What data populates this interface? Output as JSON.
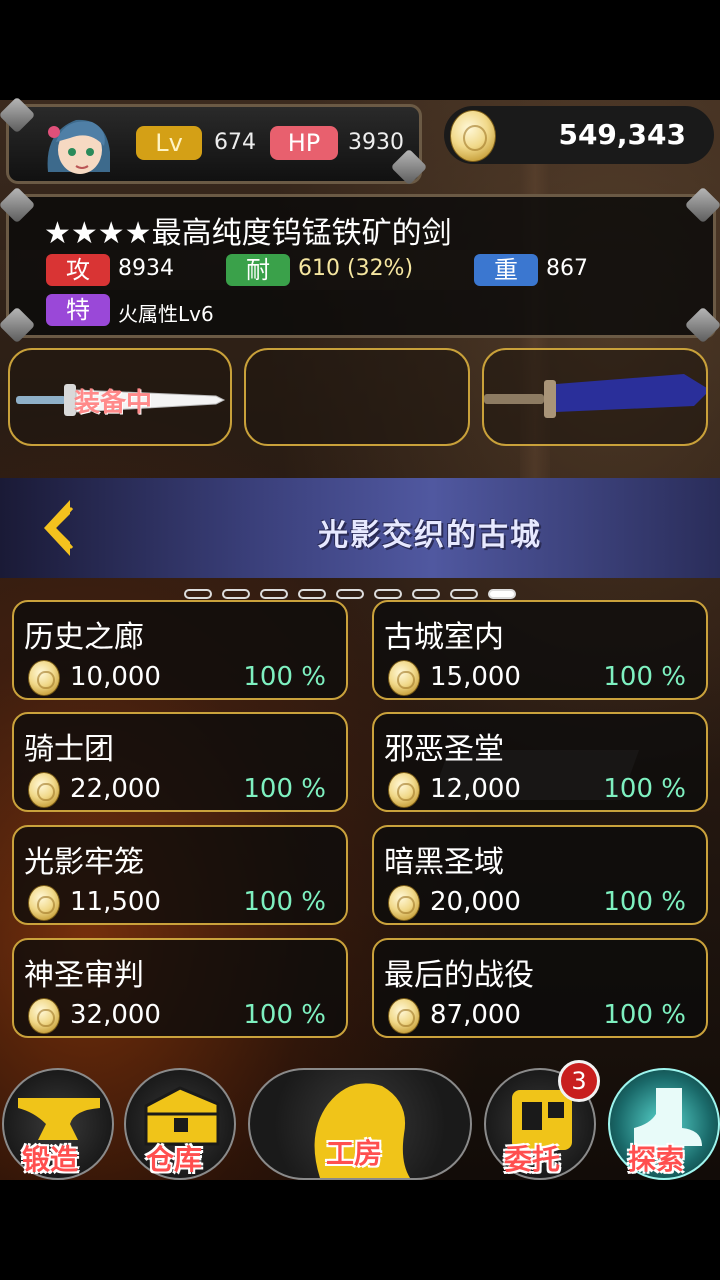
{
  "player": {
    "lv_label": "Lv",
    "lv_value": "674",
    "hp_label": "HP",
    "hp_value": "3930",
    "gold": "549,343"
  },
  "weapon": {
    "name": "★★★★最高纯度钨锰铁矿的剑",
    "atk_label": "攻",
    "atk_value": "8934",
    "dur_label": "耐",
    "dur_value": "610 (32%)",
    "wt_label": "重",
    "wt_value": "867",
    "sp_label": "特",
    "sp_value": "火属性Lv6"
  },
  "slots": {
    "equipped_label": "装备中"
  },
  "area": {
    "title": "光影交织的古城",
    "page_count": 9,
    "active_page": 9
  },
  "stages": [
    {
      "name": "历史之廊",
      "cost": "10,000",
      "pct": "100 %"
    },
    {
      "name": "古城室内",
      "cost": "15,000",
      "pct": "100 %"
    },
    {
      "name": "骑士团",
      "cost": "22,000",
      "pct": "100 %"
    },
    {
      "name": "邪恶圣堂",
      "cost": "12,000",
      "pct": "100 %"
    },
    {
      "name": "光影牢笼",
      "cost": "11,500",
      "pct": "100 %"
    },
    {
      "name": "暗黑圣域",
      "cost": "20,000",
      "pct": "100 %"
    },
    {
      "name": "神圣审判",
      "cost": "32,000",
      "pct": "100 %"
    },
    {
      "name": "最后的战役",
      "cost": "87,000",
      "pct": "100 %"
    }
  ],
  "nav": {
    "forge": "锻造",
    "warehouse": "仓库",
    "workshop": "工房",
    "commission": "委托",
    "commission_badge": "3",
    "explore": "探索"
  },
  "colors": {
    "gold_border": "#caa23c",
    "pct_text": "#7ef0c0",
    "nav_label": "#ff4f4f"
  }
}
